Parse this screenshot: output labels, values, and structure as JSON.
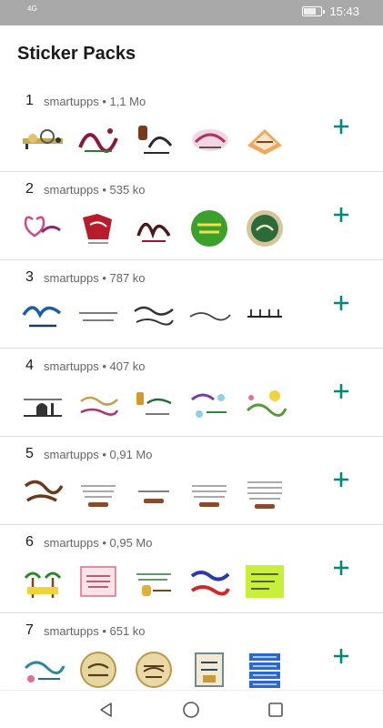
{
  "status_bar": {
    "left_text": "4G",
    "time": "15:43",
    "battery_level": 0.7
  },
  "header": {
    "title": "Sticker Packs"
  },
  "colors": {
    "accent": "#00897b",
    "status_bar_bg": "#a9a9a9",
    "divider": "#dedede"
  },
  "packs": [
    {
      "number": "1",
      "author": "smartupps",
      "size": "1,1 Mo"
    },
    {
      "number": "2",
      "author": "smartupps",
      "size": "535 ko"
    },
    {
      "number": "3",
      "author": "smartupps",
      "size": "787 ko"
    },
    {
      "number": "4",
      "author": "smartupps",
      "size": "407 ko"
    },
    {
      "number": "5",
      "author": "smartupps",
      "size": "0,91 Mo"
    },
    {
      "number": "6",
      "author": "smartupps",
      "size": "0,95 Mo"
    },
    {
      "number": "7",
      "author": "smartupps",
      "size": "651 ko"
    }
  ],
  "separator": "•",
  "icons": {
    "add": "plus-icon",
    "back": "back-triangle-icon",
    "home": "home-circle-icon",
    "recents": "recents-square-icon"
  }
}
